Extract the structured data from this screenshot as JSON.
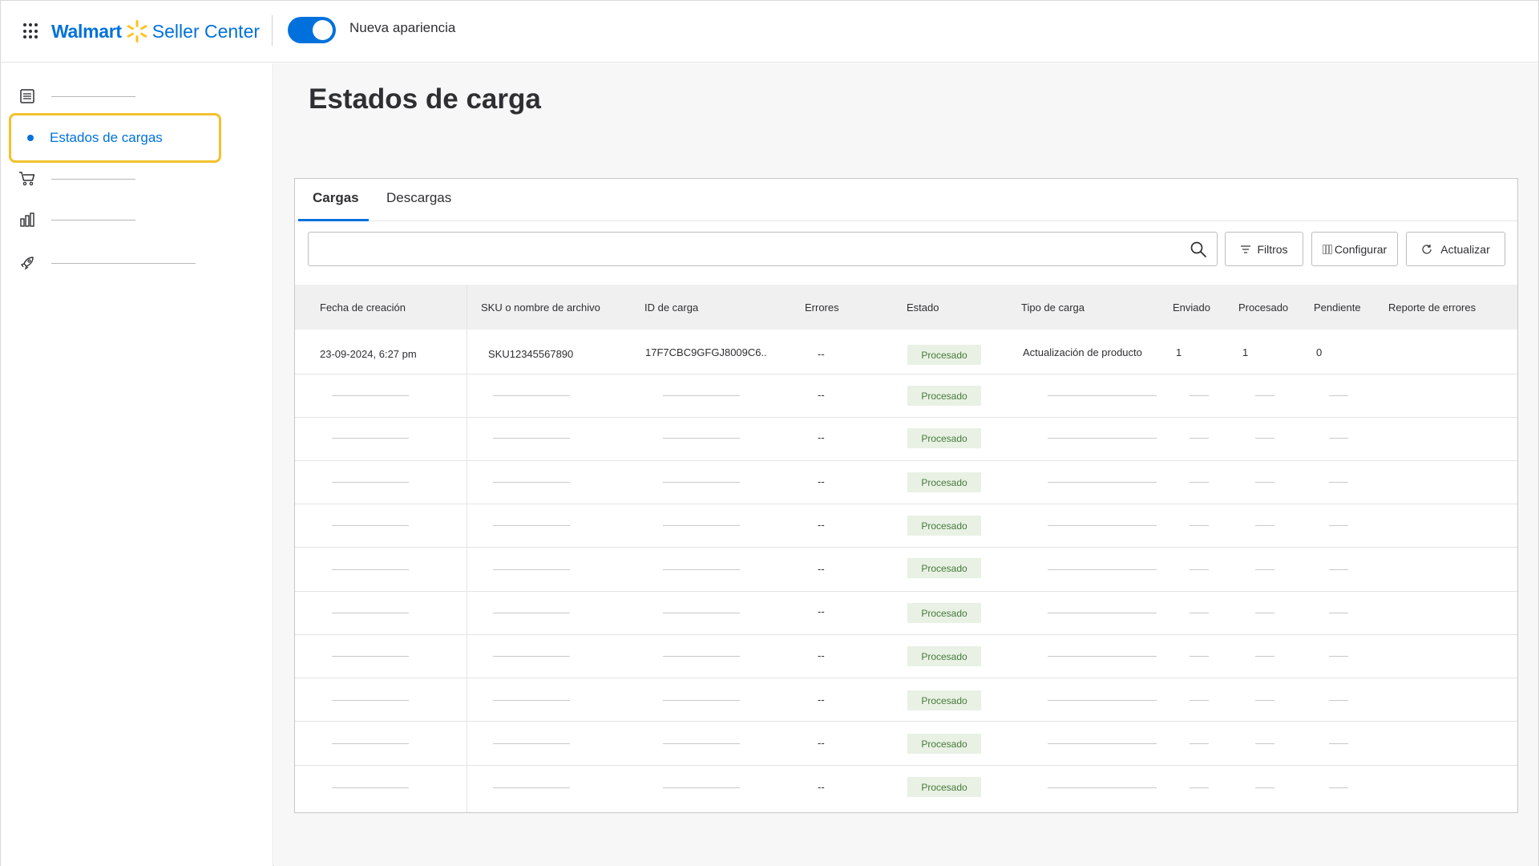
{
  "header": {
    "brand": "Walmart",
    "product": "Seller Center",
    "toggle_label": "Nueva apariencia",
    "toggle_on": true
  },
  "sidebar": {
    "items": [
      {
        "icon": "list-icon",
        "label": ""
      },
      {
        "icon": "dot-icon",
        "label": "Estados de cargas",
        "active": true
      },
      {
        "icon": "cart-icon",
        "label": ""
      },
      {
        "icon": "bar-chart-icon",
        "label": ""
      },
      {
        "icon": "rocket-icon",
        "label": ""
      }
    ]
  },
  "main": {
    "title": "Estados de carga",
    "tabs": [
      {
        "label": "Cargas",
        "active": true
      },
      {
        "label": "Descargas",
        "active": false
      }
    ],
    "search": {
      "placeholder": "",
      "value": ""
    },
    "toolbar": {
      "filters_label": "Filtros",
      "configure_label": "Configurar",
      "refresh_label": "Actualizar"
    },
    "table": {
      "columns": [
        "Fecha de creación",
        "SKU o nombre de archivo",
        "ID de carga",
        "Errores",
        "Estado",
        "Tipo de carga",
        "Enviado",
        "Procesado",
        "Pendiente",
        "Reporte de errores"
      ],
      "first_row": {
        "date": "23-09-2024, 6:27 pm",
        "sku": "SKU12345567890",
        "id": "17F7CBC9GFGJ8009C6..",
        "errors": "--",
        "status": "Procesado",
        "type": "Actualización de producto",
        "sent": "1",
        "processed": "1",
        "pending": "0",
        "report": ""
      },
      "placeholder_rows": [
        {
          "errors": "--",
          "status": "Procesado"
        },
        {
          "errors": "--",
          "status": "Procesado"
        },
        {
          "errors": "--",
          "status": "Procesado"
        },
        {
          "errors": "--",
          "status": "Procesado"
        },
        {
          "errors": "--",
          "status": "Procesado"
        },
        {
          "errors": "--",
          "status": "Procesado"
        },
        {
          "errors": "--",
          "status": "Procesado"
        },
        {
          "errors": "--",
          "status": "Procesado"
        },
        {
          "errors": "--",
          "status": "Procesado"
        },
        {
          "errors": "--",
          "status": "Procesado"
        }
      ]
    }
  },
  "colors": {
    "accent": "#0071dc",
    "highlight": "#f2c12e",
    "status_bg": "#e8f1e4",
    "status_text": "#467a3a"
  }
}
